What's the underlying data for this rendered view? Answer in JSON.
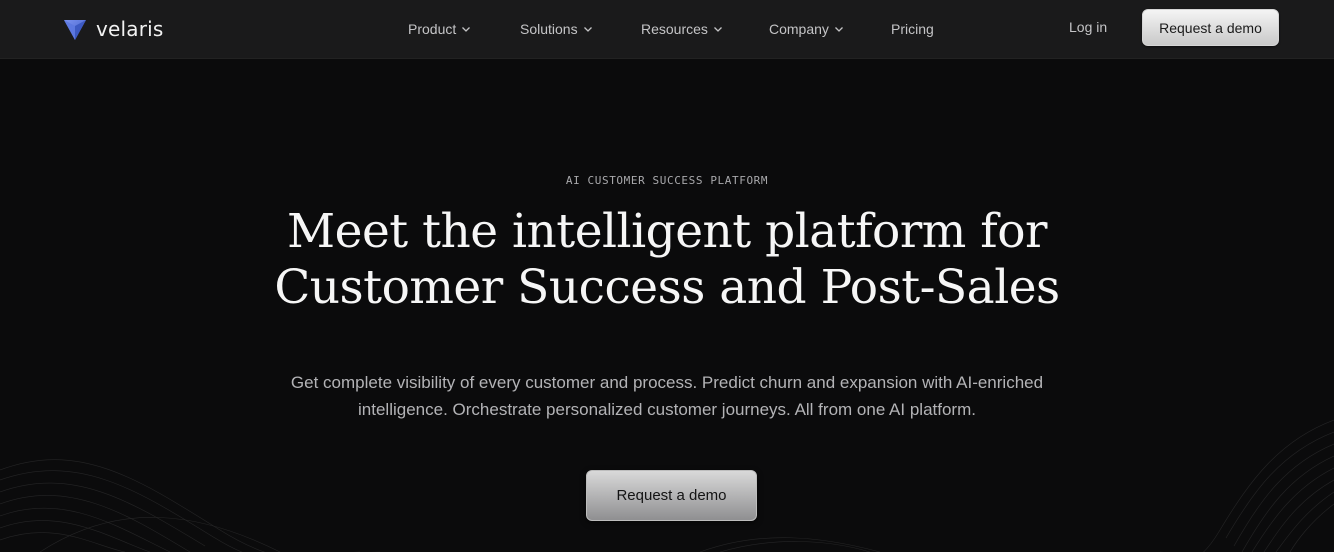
{
  "brand": {
    "name": "velaris",
    "logo_icon": "velaris-triangle-icon",
    "accent": "#4f6fd8"
  },
  "nav": {
    "items": [
      {
        "label": "Product",
        "has_dropdown": true
      },
      {
        "label": "Solutions",
        "has_dropdown": true
      },
      {
        "label": "Resources",
        "has_dropdown": true
      },
      {
        "label": "Company",
        "has_dropdown": true
      },
      {
        "label": "Pricing",
        "has_dropdown": false
      }
    ],
    "login_label": "Log in",
    "cta_label": "Request a demo"
  },
  "hero": {
    "eyebrow": "AI CUSTOMER SUCCESS PLATFORM",
    "headline_line1": "Meet the intelligent platform for",
    "headline_line2": "Customer Success and Post-Sales",
    "subtext_line1": "Get complete visibility of every customer and process. Predict churn and expansion with AI-enriched",
    "subtext_line2": "intelligence. Orchestrate personalized customer journeys. All from one AI platform.",
    "cta_label": "Request a demo"
  },
  "colors": {
    "background": "#0b0b0c",
    "navbar": "#1a1a1b",
    "button": "#d9d9d9"
  }
}
